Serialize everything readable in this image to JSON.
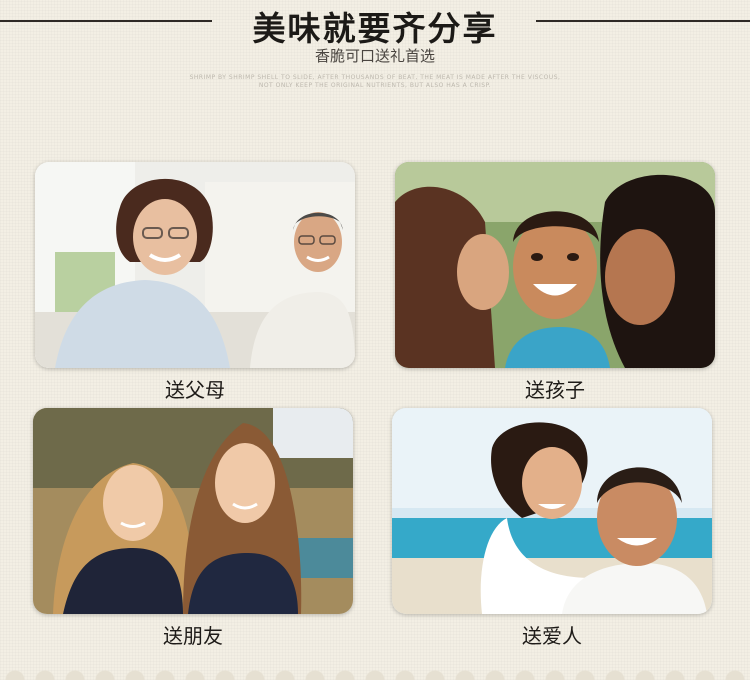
{
  "header": {
    "title": "美味就要齐分享",
    "subtitle": "香脆可口送礼首选",
    "fine_print_line1": "SHRIMP BY SHRIMP SHELL TO SLIDE, AFTER THOUSANDS OF BEAT, THE MEAT IS MADE AFTER THE VISCOUS,",
    "fine_print_line2": "NOT ONLY KEEP THE ORIGINAL NUTRIENTS, BUT ALSO HAS A CRISP."
  },
  "cards": [
    {
      "caption": "送父母"
    },
    {
      "caption": "送孩子"
    },
    {
      "caption": "送朋友"
    },
    {
      "caption": "送爱人"
    }
  ]
}
